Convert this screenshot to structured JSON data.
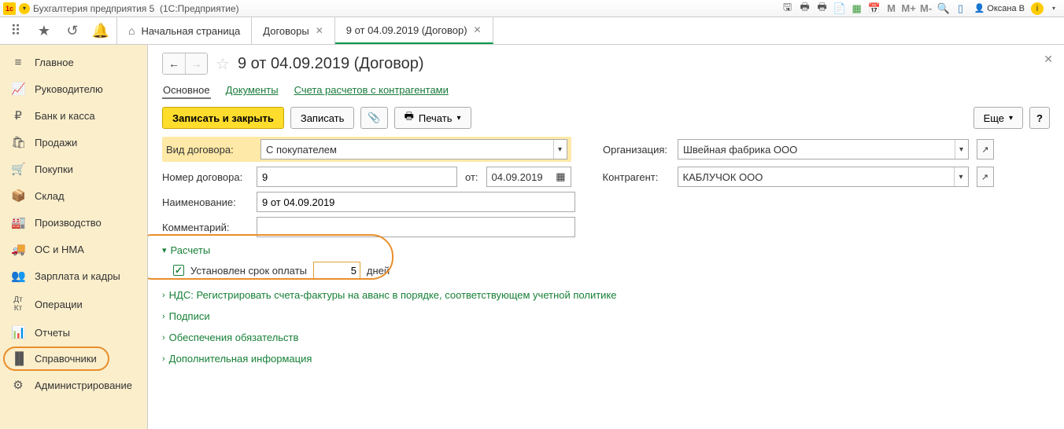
{
  "titlebar": {
    "app": "Бухгалтерия предприятия 5",
    "platform": "(1С:Предприятие)",
    "user": "Оксана В",
    "m_labels": [
      "M",
      "M+",
      "M-"
    ]
  },
  "tabs": {
    "home": "Начальная страница",
    "items": [
      {
        "label": "Договоры"
      },
      {
        "label": "9 от 04.09.2019 (Договор)"
      }
    ]
  },
  "sidebar": [
    {
      "label": "Главное"
    },
    {
      "label": "Руководителю"
    },
    {
      "label": "Банк и касса"
    },
    {
      "label": "Продажи"
    },
    {
      "label": "Покупки"
    },
    {
      "label": "Склад"
    },
    {
      "label": "Производство"
    },
    {
      "label": "ОС и НМА"
    },
    {
      "label": "Зарплата и кадры"
    },
    {
      "label": "Операции"
    },
    {
      "label": "Отчеты"
    },
    {
      "label": "Справочники"
    },
    {
      "label": "Администрирование"
    }
  ],
  "page": {
    "title": "9 от 04.09.2019 (Договор)",
    "subtabs": {
      "main": "Основное",
      "docs": "Документы",
      "accounts": "Счета расчетов с контрагентами"
    },
    "actions": {
      "save_close": "Записать и закрыть",
      "save": "Записать",
      "print": "Печать",
      "more": "Еще",
      "help": "?"
    },
    "form": {
      "contract_type_label": "Вид договора:",
      "contract_type_value": "С покупателем",
      "number_label": "Номер договора:",
      "number_value": "9",
      "from_label": "от:",
      "date_value": "04.09.2019",
      "name_label": "Наименование:",
      "name_value": "9 от 04.09.2019",
      "comment_label": "Комментарий:",
      "comment_value": "",
      "org_label": "Организация:",
      "org_value": "Швейная фабрика ООО",
      "partner_label": "Контрагент:",
      "partner_value": "КАБЛУЧОК ООО"
    },
    "sections": {
      "calc": "Расчеты",
      "payment_term_set": "Установлен срок оплаты",
      "payment_days": "5",
      "days_label": "дней",
      "nds": "НДС: Регистрировать счета-фактуры на аванс в порядке, соответствующем учетной политике",
      "signatures": "Подписи",
      "secur": "Обеспечения обязательств",
      "addinfo": "Дополнительная информация"
    }
  }
}
